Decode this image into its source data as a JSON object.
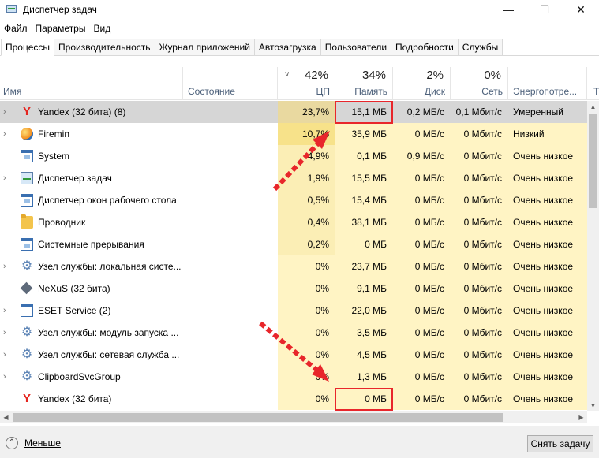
{
  "window": {
    "title": "Диспетчер задач",
    "minimize_icon": "minimize-icon",
    "maximize_icon": "maximize-icon",
    "close_icon": "close-icon"
  },
  "menu": [
    "Файл",
    "Параметры",
    "Вид"
  ],
  "tabs": [
    "Процессы",
    "Производительность",
    "Журнал приложений",
    "Автозагрузка",
    "Пользователи",
    "Подробности",
    "Службы"
  ],
  "active_tab": "Процессы",
  "columns": {
    "name": "Имя",
    "status": "Состояние",
    "cpu": {
      "pct": "42%",
      "label": "ЦП"
    },
    "memory": {
      "pct": "34%",
      "label": "Память"
    },
    "disk": {
      "pct": "2%",
      "label": "Диск"
    },
    "network": {
      "pct": "0%",
      "label": "Сеть"
    },
    "energy": "Энергопотре...",
    "extra": "Т"
  },
  "processes": [
    {
      "name": "Yandex (32 бита) (8)",
      "icon": "yandex-icon",
      "expandable": true,
      "cpu": "23,7%",
      "memory": "15,1 МБ",
      "disk": "0,2 МБ/с",
      "network": "0,1 Мбит/с",
      "energy": "Умеренный",
      "selected": true
    },
    {
      "name": "Firemin",
      "icon": "firemin-icon",
      "expandable": true,
      "cpu": "10,7%",
      "memory": "35,9 МБ",
      "disk": "0 МБ/с",
      "network": "0 Мбит/с",
      "energy": "Низкий"
    },
    {
      "name": "System",
      "icon": "window-icon",
      "expandable": false,
      "cpu": "4,9%",
      "memory": "0,1 МБ",
      "disk": "0,9 МБ/с",
      "network": "0 Мбит/с",
      "energy": "Очень низкое"
    },
    {
      "name": "Диспетчер задач",
      "icon": "task-manager-icon",
      "expandable": true,
      "cpu": "1,9%",
      "memory": "15,5 МБ",
      "disk": "0 МБ/с",
      "network": "0 Мбит/с",
      "energy": "Очень низкое"
    },
    {
      "name": "Диспетчер окон рабочего стола",
      "icon": "window-icon",
      "expandable": false,
      "cpu": "0,5%",
      "memory": "15,4 МБ",
      "disk": "0 МБ/с",
      "network": "0 Мбит/с",
      "energy": "Очень низкое"
    },
    {
      "name": "Проводник",
      "icon": "folder-icon",
      "expandable": false,
      "cpu": "0,4%",
      "memory": "38,1 МБ",
      "disk": "0 МБ/с",
      "network": "0 Мбит/с",
      "energy": "Очень низкое"
    },
    {
      "name": "Системные прерывания",
      "icon": "window-icon",
      "expandable": false,
      "cpu": "0,2%",
      "memory": "0 МБ",
      "disk": "0 МБ/с",
      "network": "0 Мбит/с",
      "energy": "Очень низкое"
    },
    {
      "name": "Узел службы: локальная систе...",
      "icon": "gear-icon",
      "expandable": true,
      "cpu": "0%",
      "memory": "23,7 МБ",
      "disk": "0 МБ/с",
      "network": "0 Мбит/с",
      "energy": "Очень низкое"
    },
    {
      "name": "NeXuS (32 бита)",
      "icon": "nexus-icon",
      "expandable": false,
      "cpu": "0%",
      "memory": "9,1 МБ",
      "disk": "0 МБ/с",
      "network": "0 Мбит/с",
      "energy": "Очень низкое"
    },
    {
      "name": "ESET Service (2)",
      "icon": "eset-icon",
      "expandable": true,
      "cpu": "0%",
      "memory": "22,0 МБ",
      "disk": "0 МБ/с",
      "network": "0 Мбит/с",
      "energy": "Очень низкое"
    },
    {
      "name": "Узел службы: модуль запуска ...",
      "icon": "gear-icon",
      "expandable": true,
      "cpu": "0%",
      "memory": "3,5 МБ",
      "disk": "0 МБ/с",
      "network": "0 Мбит/с",
      "energy": "Очень низкое"
    },
    {
      "name": "Узел службы: сетевая служба ...",
      "icon": "gear-icon",
      "expandable": true,
      "cpu": "0%",
      "memory": "4,5 МБ",
      "disk": "0 МБ/с",
      "network": "0 Мбит/с",
      "energy": "Очень низкое"
    },
    {
      "name": "ClipboardSvcGroup",
      "icon": "gear-icon",
      "expandable": true,
      "cpu": "0%",
      "memory": "1,3 МБ",
      "disk": "0 МБ/с",
      "network": "0 Мбит/с",
      "energy": "Очень низкое"
    },
    {
      "name": "Yandex (32 бита)",
      "icon": "yandex-icon",
      "expandable": false,
      "cpu": "0%",
      "memory": "0 МБ",
      "disk": "0 МБ/с",
      "network": "0 Мбит/с",
      "energy": "Очень низкое"
    }
  ],
  "footer": {
    "less_label": "Меньше",
    "end_task": "Снять задачу"
  },
  "colors": {
    "heat_high": "#f7e28a",
    "heat_mid": "#fbeeb5",
    "heat_low": "#fff4c4",
    "selected_row": "#d6d6d6",
    "annotation_red": "#e8262b"
  }
}
